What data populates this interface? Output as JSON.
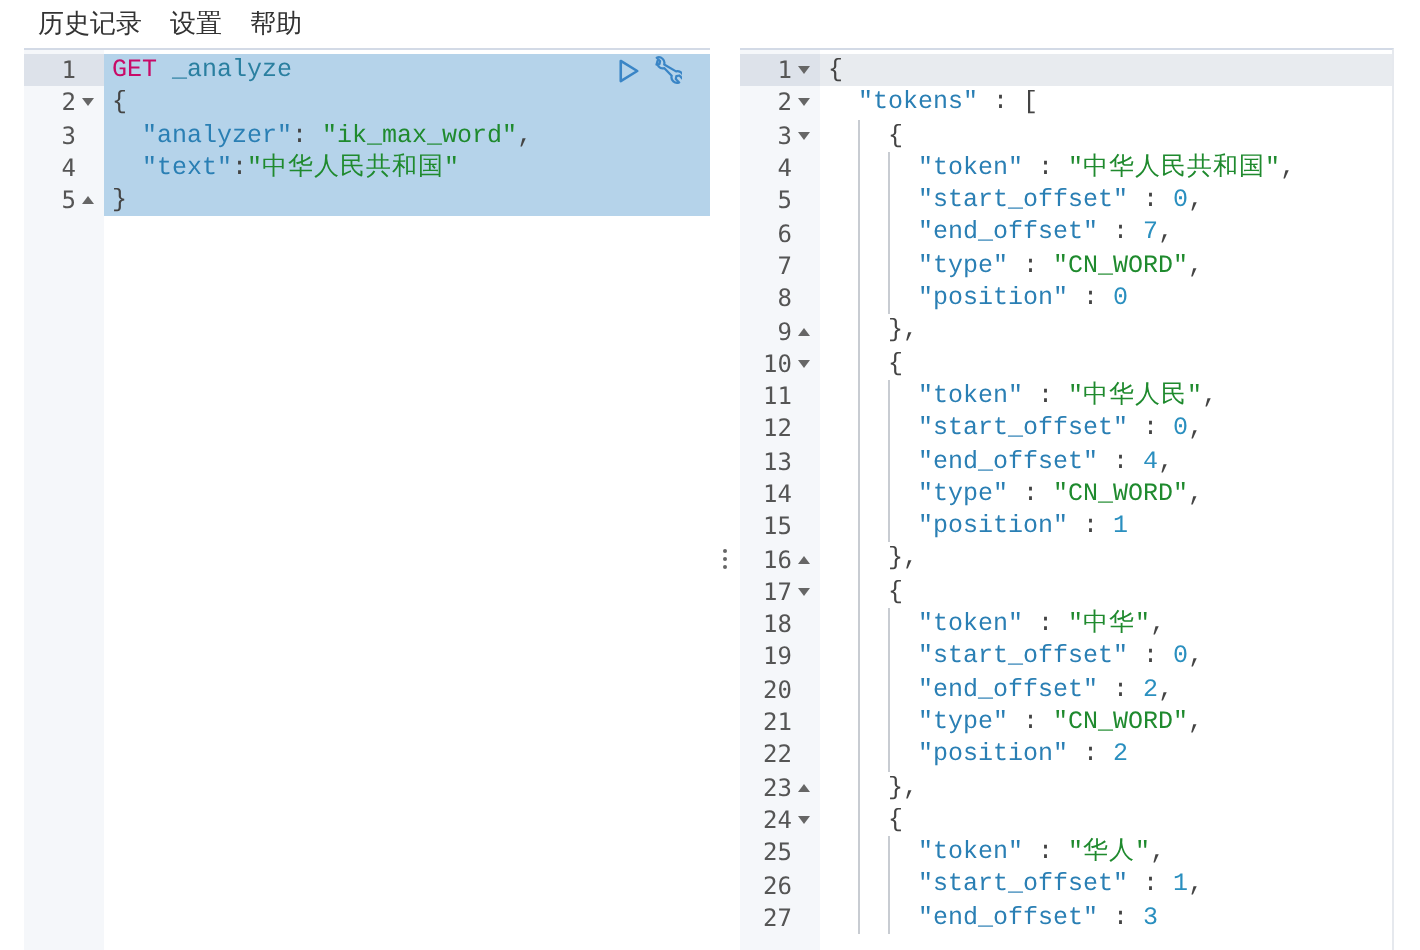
{
  "menu": [
    {
      "label": "历史记录"
    },
    {
      "label": "设置"
    },
    {
      "label": "帮助"
    }
  ],
  "request": {
    "lines": [
      {
        "number": "1",
        "kind": "plain",
        "active": true,
        "selected": true,
        "tokens": [
          {
            "kind": "kw",
            "text": "GET"
          },
          {
            "kind": "path",
            "text": " _analyze"
          }
        ]
      },
      {
        "number": "2",
        "kind": "opener",
        "active": false,
        "selected": true,
        "tokens": [
          {
            "kind": "punct",
            "text": "{"
          }
        ]
      },
      {
        "number": "3",
        "kind": "plain",
        "active": false,
        "selected": true,
        "tokens": [
          {
            "kind": "key",
            "text": "  \"analyzer\""
          },
          {
            "kind": "punct",
            "text": ": "
          },
          {
            "kind": "str",
            "text": "\"ik_max_word\""
          },
          {
            "kind": "punct",
            "text": ","
          }
        ]
      },
      {
        "number": "4",
        "kind": "plain",
        "active": false,
        "selected": true,
        "tokens": [
          {
            "kind": "key",
            "text": "  \"text\""
          },
          {
            "kind": "punct",
            "text": ":"
          },
          {
            "kind": "str",
            "text": "\"中华人民共和国\""
          }
        ]
      },
      {
        "number": "5",
        "kind": "closer",
        "active": false,
        "selected": true,
        "tokens": [
          {
            "kind": "punct",
            "text": "}"
          }
        ]
      }
    ]
  },
  "response": {
    "lines": [
      {
        "number": "1",
        "kind": "opener",
        "active": true,
        "tokens": [
          {
            "kind": "punct",
            "text": "{"
          }
        ]
      },
      {
        "number": "2",
        "kind": "opener",
        "active": false,
        "tokens": [
          {
            "kind": "key",
            "text": "  \"tokens\""
          },
          {
            "kind": "punct",
            "text": " : ["
          }
        ]
      },
      {
        "number": "3",
        "kind": "opener",
        "active": false,
        "tokens": [
          {
            "kind": "punct",
            "text": "    {"
          }
        ]
      },
      {
        "number": "4",
        "kind": "plain",
        "active": false,
        "tokens": [
          {
            "kind": "key",
            "text": "      \"token\""
          },
          {
            "kind": "punct",
            "text": " : "
          },
          {
            "kind": "str",
            "text": "\"中华人民共和国\""
          },
          {
            "kind": "punct",
            "text": ","
          }
        ]
      },
      {
        "number": "5",
        "kind": "plain",
        "active": false,
        "tokens": [
          {
            "kind": "key",
            "text": "      \"start_offset\""
          },
          {
            "kind": "punct",
            "text": " : "
          },
          {
            "kind": "num",
            "text": "0"
          },
          {
            "kind": "punct",
            "text": ","
          }
        ]
      },
      {
        "number": "6",
        "kind": "plain",
        "active": false,
        "tokens": [
          {
            "kind": "key",
            "text": "      \"end_offset\""
          },
          {
            "kind": "punct",
            "text": " : "
          },
          {
            "kind": "num",
            "text": "7"
          },
          {
            "kind": "punct",
            "text": ","
          }
        ]
      },
      {
        "number": "7",
        "kind": "plain",
        "active": false,
        "tokens": [
          {
            "kind": "key",
            "text": "      \"type\""
          },
          {
            "kind": "punct",
            "text": " : "
          },
          {
            "kind": "str",
            "text": "\"CN_WORD\""
          },
          {
            "kind": "punct",
            "text": ","
          }
        ]
      },
      {
        "number": "8",
        "kind": "plain",
        "active": false,
        "tokens": [
          {
            "kind": "key",
            "text": "      \"position\""
          },
          {
            "kind": "punct",
            "text": " : "
          },
          {
            "kind": "num",
            "text": "0"
          }
        ]
      },
      {
        "number": "9",
        "kind": "closer",
        "active": false,
        "tokens": [
          {
            "kind": "punct",
            "text": "    },"
          }
        ]
      },
      {
        "number": "10",
        "kind": "opener",
        "active": false,
        "tokens": [
          {
            "kind": "punct",
            "text": "    {"
          }
        ]
      },
      {
        "number": "11",
        "kind": "plain",
        "active": false,
        "tokens": [
          {
            "kind": "key",
            "text": "      \"token\""
          },
          {
            "kind": "punct",
            "text": " : "
          },
          {
            "kind": "str",
            "text": "\"中华人民\""
          },
          {
            "kind": "punct",
            "text": ","
          }
        ]
      },
      {
        "number": "12",
        "kind": "plain",
        "active": false,
        "tokens": [
          {
            "kind": "key",
            "text": "      \"start_offset\""
          },
          {
            "kind": "punct",
            "text": " : "
          },
          {
            "kind": "num",
            "text": "0"
          },
          {
            "kind": "punct",
            "text": ","
          }
        ]
      },
      {
        "number": "13",
        "kind": "plain",
        "active": false,
        "tokens": [
          {
            "kind": "key",
            "text": "      \"end_offset\""
          },
          {
            "kind": "punct",
            "text": " : "
          },
          {
            "kind": "num",
            "text": "4"
          },
          {
            "kind": "punct",
            "text": ","
          }
        ]
      },
      {
        "number": "14",
        "kind": "plain",
        "active": false,
        "tokens": [
          {
            "kind": "key",
            "text": "      \"type\""
          },
          {
            "kind": "punct",
            "text": " : "
          },
          {
            "kind": "str",
            "text": "\"CN_WORD\""
          },
          {
            "kind": "punct",
            "text": ","
          }
        ]
      },
      {
        "number": "15",
        "kind": "plain",
        "active": false,
        "tokens": [
          {
            "kind": "key",
            "text": "      \"position\""
          },
          {
            "kind": "punct",
            "text": " : "
          },
          {
            "kind": "num",
            "text": "1"
          }
        ]
      },
      {
        "number": "16",
        "kind": "closer",
        "active": false,
        "tokens": [
          {
            "kind": "punct",
            "text": "    },"
          }
        ]
      },
      {
        "number": "17",
        "kind": "opener",
        "active": false,
        "tokens": [
          {
            "kind": "punct",
            "text": "    {"
          }
        ]
      },
      {
        "number": "18",
        "kind": "plain",
        "active": false,
        "tokens": [
          {
            "kind": "key",
            "text": "      \"token\""
          },
          {
            "kind": "punct",
            "text": " : "
          },
          {
            "kind": "str",
            "text": "\"中华\""
          },
          {
            "kind": "punct",
            "text": ","
          }
        ]
      },
      {
        "number": "19",
        "kind": "plain",
        "active": false,
        "tokens": [
          {
            "kind": "key",
            "text": "      \"start_offset\""
          },
          {
            "kind": "punct",
            "text": " : "
          },
          {
            "kind": "num",
            "text": "0"
          },
          {
            "kind": "punct",
            "text": ","
          }
        ]
      },
      {
        "number": "20",
        "kind": "plain",
        "active": false,
        "tokens": [
          {
            "kind": "key",
            "text": "      \"end_offset\""
          },
          {
            "kind": "punct",
            "text": " : "
          },
          {
            "kind": "num",
            "text": "2"
          },
          {
            "kind": "punct",
            "text": ","
          }
        ]
      },
      {
        "number": "21",
        "kind": "plain",
        "active": false,
        "tokens": [
          {
            "kind": "key",
            "text": "      \"type\""
          },
          {
            "kind": "punct",
            "text": " : "
          },
          {
            "kind": "str",
            "text": "\"CN_WORD\""
          },
          {
            "kind": "punct",
            "text": ","
          }
        ]
      },
      {
        "number": "22",
        "kind": "plain",
        "active": false,
        "tokens": [
          {
            "kind": "key",
            "text": "      \"position\""
          },
          {
            "kind": "punct",
            "text": " : "
          },
          {
            "kind": "num",
            "text": "2"
          }
        ]
      },
      {
        "number": "23",
        "kind": "closer",
        "active": false,
        "tokens": [
          {
            "kind": "punct",
            "text": "    },"
          }
        ]
      },
      {
        "number": "24",
        "kind": "opener",
        "active": false,
        "tokens": [
          {
            "kind": "punct",
            "text": "    {"
          }
        ]
      },
      {
        "number": "25",
        "kind": "plain",
        "active": false,
        "tokens": [
          {
            "kind": "key",
            "text": "      \"token\""
          },
          {
            "kind": "punct",
            "text": " : "
          },
          {
            "kind": "str",
            "text": "\"华人\""
          },
          {
            "kind": "punct",
            "text": ","
          }
        ]
      },
      {
        "number": "26",
        "kind": "plain",
        "active": false,
        "tokens": [
          {
            "kind": "key",
            "text": "      \"start_offset\""
          },
          {
            "kind": "punct",
            "text": " : "
          },
          {
            "kind": "num",
            "text": "1"
          },
          {
            "kind": "punct",
            "text": ","
          }
        ]
      },
      {
        "number": "27",
        "kind": "plain",
        "active": false,
        "tokens": [
          {
            "kind": "key",
            "text": "      \"end_offset\""
          },
          {
            "kind": "punct",
            "text": " : "
          },
          {
            "kind": "num",
            "text": "3"
          }
        ]
      }
    ]
  }
}
